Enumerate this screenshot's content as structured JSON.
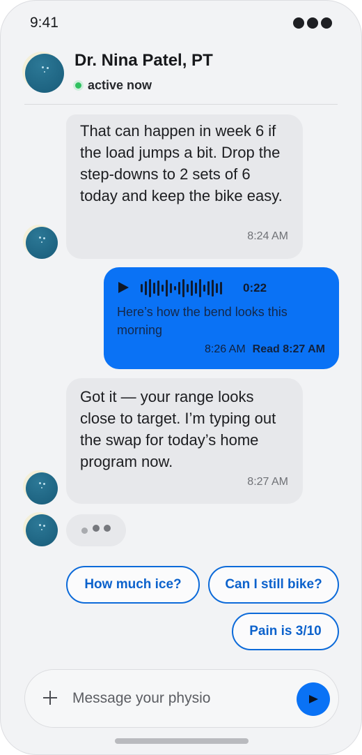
{
  "status_bar": {
    "time": "9:41"
  },
  "header": {
    "name": "Dr. Nina Patel, PT",
    "presence": "active now"
  },
  "messages": [
    {
      "text": "That can happen in week 6 if the load jumps a bit. Drop the step-downs to 2 sets of 6 today and keep the bike easy.",
      "time": "8:24 AM"
    },
    {
      "duration": "0:22",
      "caption": "Here’s how the bend looks this morning",
      "time": "8:26 AM",
      "read": "Read 8:27 AM"
    },
    {
      "text": "Got it — your range looks close to target. I’m typing out the swap for today’s home program now.",
      "time": "8:27 AM"
    }
  ],
  "quick_replies": [
    "How much ice?",
    "Can I still bike?",
    "Pain is 3/10"
  ],
  "composer": {
    "placeholder": "Message your physio"
  },
  "colors": {
    "accent": "#0a72f5",
    "incoming_bubble": "#e7e8eb",
    "presence": "#2ec15f"
  }
}
